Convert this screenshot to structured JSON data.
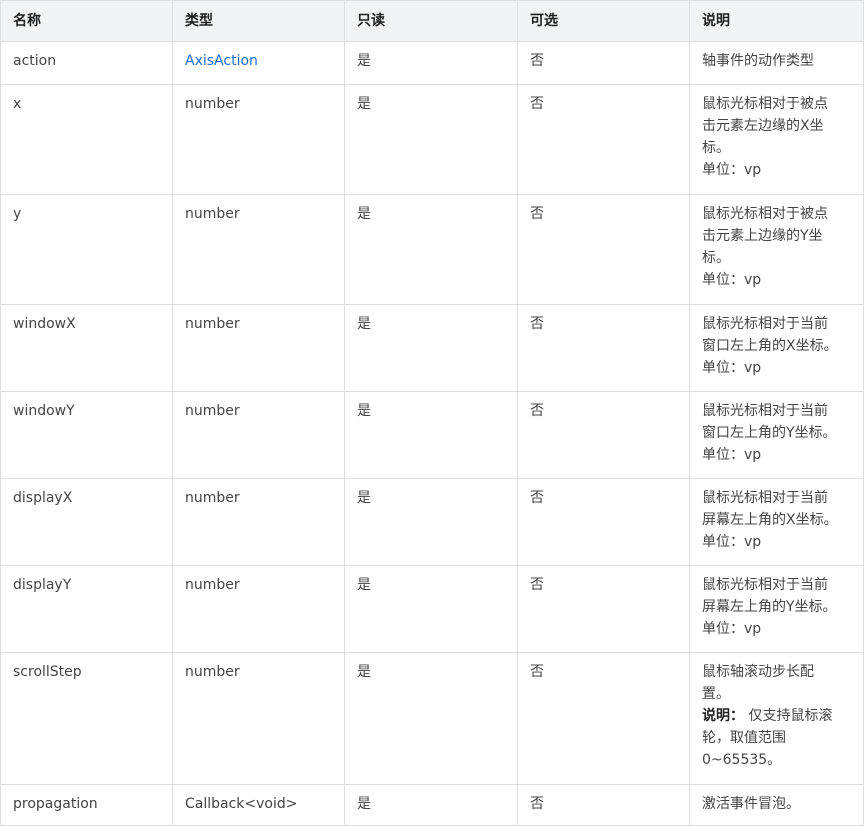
{
  "headers": [
    "名称",
    "类型",
    "只读",
    "可选",
    "说明"
  ],
  "rows": [
    {
      "name": "action",
      "type": "AxisAction",
      "readonly": "是",
      "optional": "否",
      "desc": [
        "轴事件的动作类型"
      ]
    },
    {
      "name": "x",
      "type": "number",
      "readonly": "是",
      "optional": "否",
      "desc": [
        "鼠标光标相对于被点",
        "击元素左边缘的X坐",
        "标。",
        "单位：vp"
      ]
    },
    {
      "name": "y",
      "type": "number",
      "readonly": "是",
      "optional": "否",
      "desc": [
        "鼠标光标相对于被点",
        "击元素上边缘的Y坐",
        "标。",
        "单位：vp"
      ]
    },
    {
      "name": "windowX",
      "type": "number",
      "readonly": "是",
      "optional": "否",
      "desc": [
        "鼠标光标相对于当前",
        "窗口左上角的X坐标。",
        "单位：vp"
      ]
    },
    {
      "name": "windowY",
      "type": "number",
      "readonly": "是",
      "optional": "否",
      "desc": [
        "鼠标光标相对于当前",
        "窗口左上角的Y坐标。",
        "单位：vp"
      ]
    },
    {
      "name": "displayX",
      "type": "number",
      "readonly": "是",
      "optional": "否",
      "desc": [
        "鼠标光标相对于当前",
        "屏幕左上角的X坐标。",
        "单位：vp"
      ]
    },
    {
      "name": "displayY",
      "type": "number",
      "readonly": "是",
      "optional": "否",
      "desc": [
        "鼠标光标相对于当前",
        "屏幕左上角的Y坐标。",
        "单位：vp"
      ]
    },
    {
      "name": "scrollStep",
      "type": "number",
      "readonly": "是",
      "optional": "否",
      "desc": [
        "鼠标轴滚动步长配",
        "置。"
      ],
      "note_label": "说明：",
      "note": [
        "仅支持鼠标滚",
        "轮，取值范围",
        "0~65535。"
      ]
    },
    {
      "name": "propagation",
      "type": "Callback<void>",
      "readonly": "是",
      "optional": "否",
      "desc": [
        "激活事件冒泡。"
      ]
    }
  ]
}
